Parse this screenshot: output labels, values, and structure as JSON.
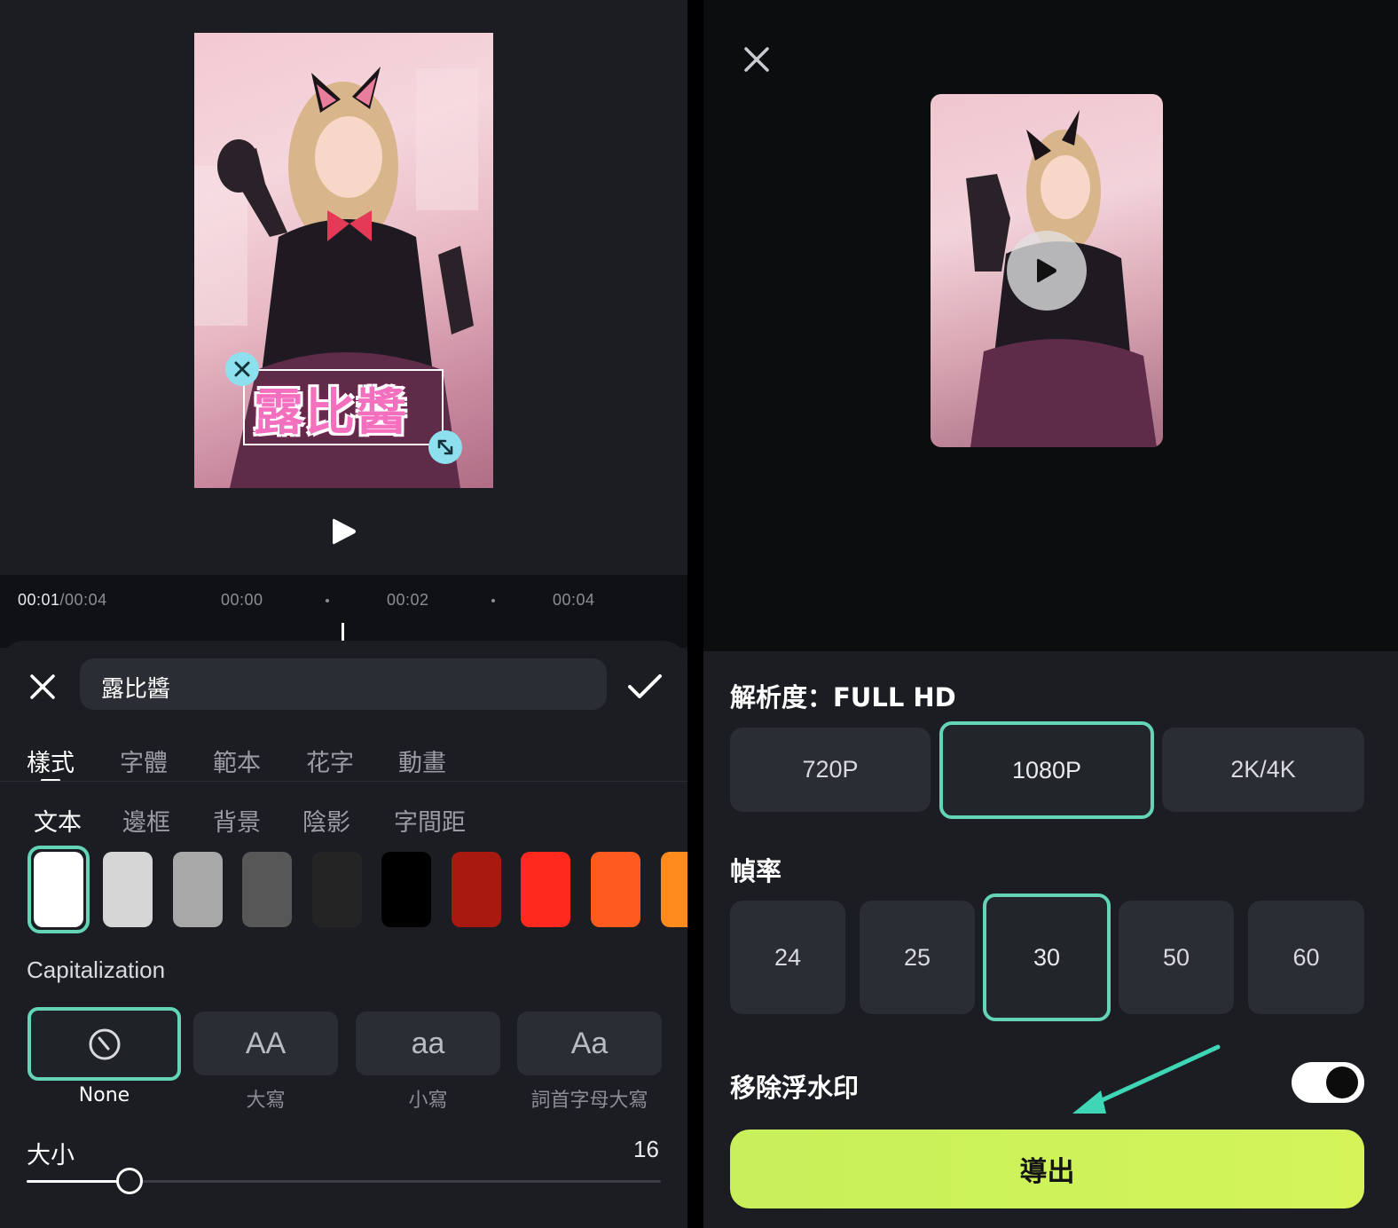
{
  "editor": {
    "timeline": {
      "current_time": "00:01",
      "total_time": "/00:04",
      "ticks": [
        "00:00",
        "00:02",
        "00:04"
      ]
    },
    "sticker_text": "露比醬",
    "text_input_value": "露比醬",
    "tabs": [
      "樣式",
      "字體",
      "範本",
      "花字",
      "動畫"
    ],
    "subtabs": [
      "文本",
      "邊框",
      "背景",
      "陰影",
      "字間距"
    ],
    "swatches": [
      "#ffffff",
      "#d6d6d6",
      "#a8a8a8",
      "#575757",
      "#242424",
      "#000000",
      "#a8190f",
      "#ff2a1d",
      "#ff5b1f",
      "#ff8a1e"
    ],
    "capitalization": {
      "title": "Capitalization",
      "options": [
        {
          "glyph": "",
          "label": "None"
        },
        {
          "glyph": "AA",
          "label": "大寫"
        },
        {
          "glyph": "aa",
          "label": "小寫"
        },
        {
          "glyph": "Aa",
          "label": "詞首字母大寫"
        }
      ]
    },
    "size": {
      "label": "大小",
      "value": "16"
    }
  },
  "export": {
    "resolution_title": "解析度：FULL HD",
    "resolutions": [
      "720P",
      "1080P",
      "2K/4K"
    ],
    "selected_resolution": "1080P",
    "fps_title": "幀率",
    "fps_options": [
      "24",
      "25",
      "30",
      "50",
      "60"
    ],
    "selected_fps": "30",
    "watermark_label": "移除浮水印",
    "watermark_toggle_on": true,
    "export_button": "導出"
  },
  "colors": {
    "accent": "#63d5b6",
    "export_button": "#cdf25a",
    "annotation_arrow": "#3fd6b6"
  },
  "icons": [
    "close-icon",
    "check-icon",
    "play-icon",
    "resize-icon",
    "none-icon"
  ]
}
